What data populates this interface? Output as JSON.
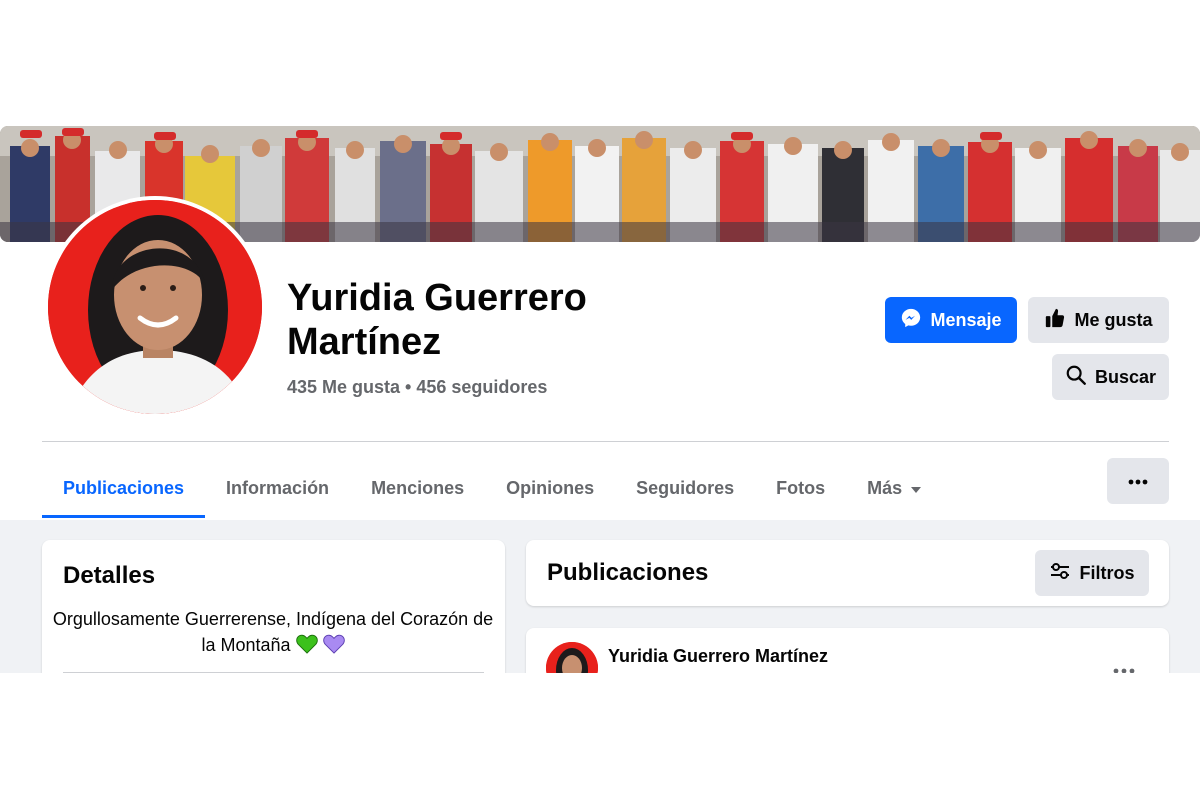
{
  "page": {
    "name": "Yuridia Guerrero Martínez",
    "stats": "435 Me gusta • 456 seguidores"
  },
  "actions": {
    "message": "Mensaje",
    "like": "Me gusta",
    "search": "Buscar"
  },
  "tabs": [
    {
      "label": "Publicaciones",
      "active": true
    },
    {
      "label": "Información"
    },
    {
      "label": "Menciones"
    },
    {
      "label": "Opiniones"
    },
    {
      "label": "Seguidores"
    },
    {
      "label": "Fotos"
    },
    {
      "label": "Más"
    }
  ],
  "details": {
    "title": "Detalles",
    "bio": "Orgullosamente Guerrerense, Indígena del Corazón de la Montaña",
    "bio_emojis": [
      "green-heart-icon",
      "purple-heart-icon"
    ]
  },
  "posts": {
    "title": "Publicaciones",
    "filter": "Filtros",
    "first_post_author": "Yuridia Guerrero Martínez"
  },
  "colors": {
    "accent": "#0866ff",
    "secondary_bg": "#e4e6eb",
    "feed_bg": "#f0f2f5",
    "avatar_bg": "#e8211c"
  }
}
